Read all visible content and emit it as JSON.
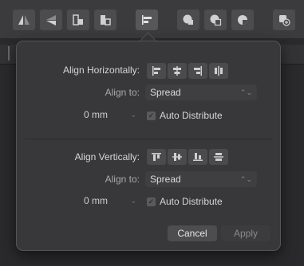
{
  "toolbar": {
    "buttons": [
      {
        "icon": "flip-horizontal-icon"
      },
      {
        "icon": "flip-vertical-icon"
      },
      {
        "icon": "rotate-left-icon"
      },
      {
        "icon": "rotate-right-icon"
      },
      {
        "icon": "align-icon"
      },
      {
        "icon": "boolean-add-icon"
      },
      {
        "icon": "boolean-subtract-icon"
      },
      {
        "icon": "boolean-intersect-icon"
      },
      {
        "icon": "insert-inside-icon"
      }
    ]
  },
  "align_h": {
    "label": "Align Horizontally:",
    "align_to_label": "Align to:",
    "align_to_value": "Spread",
    "spacing_value": "0 mm",
    "auto_distribute_label": "Auto Distribute",
    "auto_distribute_checked": true
  },
  "align_v": {
    "label": "Align Vertically:",
    "align_to_label": "Align to:",
    "align_to_value": "Spread",
    "spacing_value": "0 mm",
    "auto_distribute_label": "Auto Distribute",
    "auto_distribute_checked": true
  },
  "footer": {
    "cancel_label": "Cancel",
    "apply_label": "Apply"
  },
  "colors": {
    "panel": "#38383a",
    "background": "#2a2a2c",
    "button": "#4b4b4d"
  }
}
